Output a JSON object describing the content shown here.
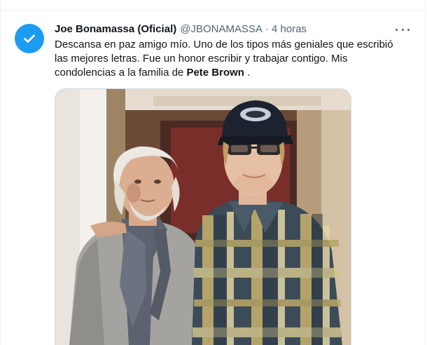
{
  "tweet": {
    "author": {
      "display_name": "Joe Bonamassa (Oficial)",
      "handle": "@JBONAMASSA",
      "separator": "·",
      "timestamp": "4 horas"
    },
    "text_before_mention": "Descansa en paz amigo mío. Uno de los tipos más geniales que escribió las mejores letras. Fue un honor escribir y trabajar contigo. Mis condolencias a la familia de ",
    "mention": "Pete Brown",
    "text_after_mention": " .",
    "photo": {
      "subject": "photo-two-men-studio"
    }
  },
  "colors": {
    "accent": "#1d9bf0",
    "secondary_text": "#536471",
    "primary_text": "#0f1419",
    "border": "#eff3f4"
  },
  "icons": {
    "avatar": "verified-check-icon",
    "more": "more-horizontal-icon"
  }
}
